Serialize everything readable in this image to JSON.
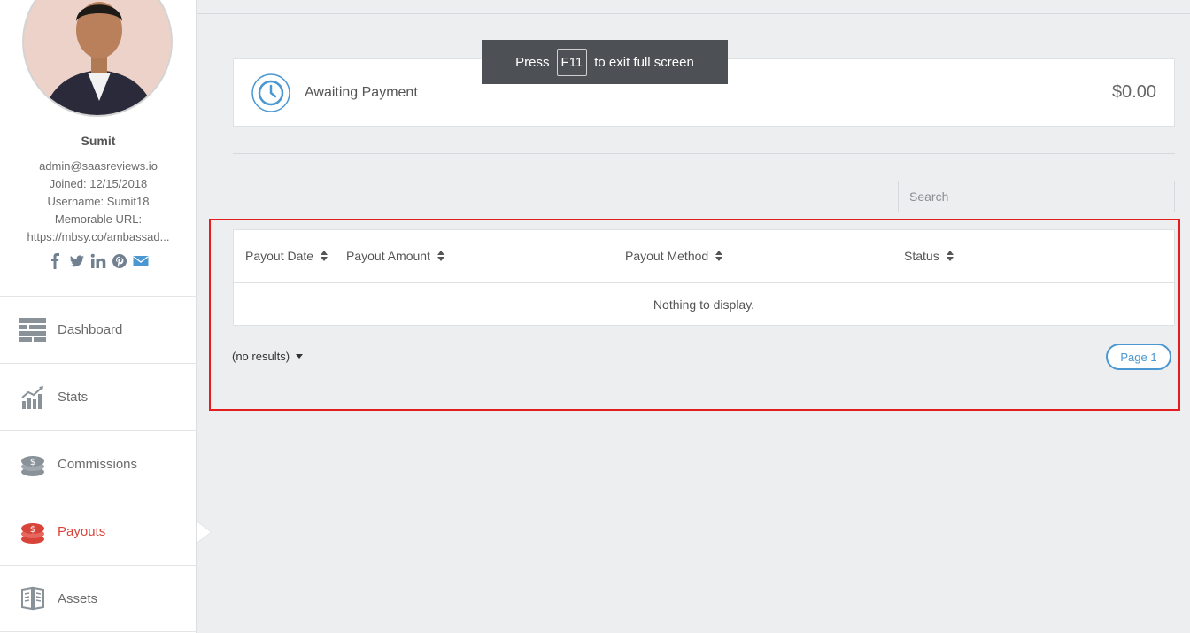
{
  "profile": {
    "name": "Sumit",
    "email": "admin@saasreviews.io",
    "joined": "Joined: 12/15/2018",
    "username": "Username: Sumit18",
    "memorable_label": "Memorable URL:",
    "memorable_url": "https://mbsy.co/ambassad..."
  },
  "social_icons": [
    "facebook-icon",
    "twitter-icon",
    "linkedin-icon",
    "pinterest-icon",
    "email-icon"
  ],
  "nav": {
    "items": [
      {
        "label": "Dashboard",
        "icon": "dashboard-icon"
      },
      {
        "label": "Stats",
        "icon": "stats-icon"
      },
      {
        "label": "Commissions",
        "icon": "commissions-icon"
      },
      {
        "label": "Payouts",
        "icon": "payouts-icon",
        "active": true
      },
      {
        "label": "Assets",
        "icon": "assets-icon"
      }
    ]
  },
  "awaiting": {
    "label": "Awaiting Payment",
    "amount": "$0.00"
  },
  "search": {
    "placeholder": "Search",
    "value": ""
  },
  "table": {
    "columns": [
      "Payout Date",
      "Payout Amount",
      "Payout Method",
      "Status"
    ],
    "empty_message": "Nothing to display."
  },
  "pagination": {
    "results_label": "(no results)",
    "page_label": "Page 1"
  },
  "toast": {
    "prefix": "Press",
    "key": "F11",
    "suffix": "to exit full screen"
  },
  "colors": {
    "accent_blue": "#4a97d2",
    "active_red": "#d9443a",
    "highlight_red": "#e41e1e"
  }
}
